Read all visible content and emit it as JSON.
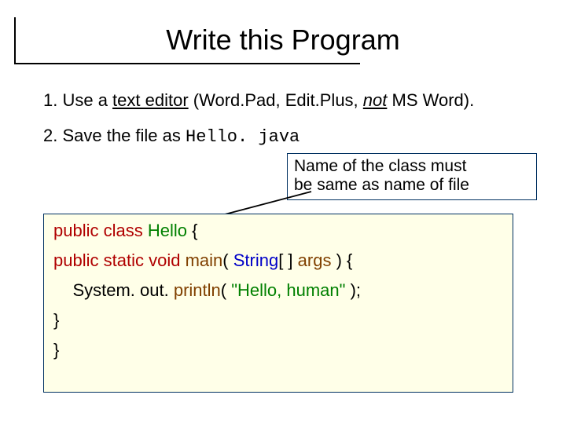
{
  "title": "Write this Program",
  "steps": {
    "one_full": "1. Use a text editor (Word.Pad, Edit.Plus, not MS Word).",
    "one_prefix": "1. Use a ",
    "one_underlined": "text editor",
    "one_mid": " (Word.Pad, Edit.Plus, ",
    "one_not": "not",
    "one_suffix": " MS Word).",
    "two_prefix": "2.  Save the file as ",
    "two_filename": "Hello. java"
  },
  "note": {
    "line1": "Name of the class must",
    "line2": "be same as name of file"
  },
  "code": {
    "l1": {
      "kw1": "public",
      "kw2": "class",
      "cls": "Hello",
      "open": " {"
    },
    "l2": {
      "kw1": "public",
      "kw2": "static",
      "kw3": "void",
      "main": "main",
      "sig_open": "( ",
      "type": "String",
      "arr": "[ ] ",
      "args": "args",
      "sig_close": " ) {"
    },
    "l3": {
      "indent": "    ",
      "obj": "System. out. ",
      "call": "println",
      "open": "( ",
      "str": "\"Hello, human\"",
      "close": " ); "
    },
    "l4": "}",
    "l5": "}"
  }
}
